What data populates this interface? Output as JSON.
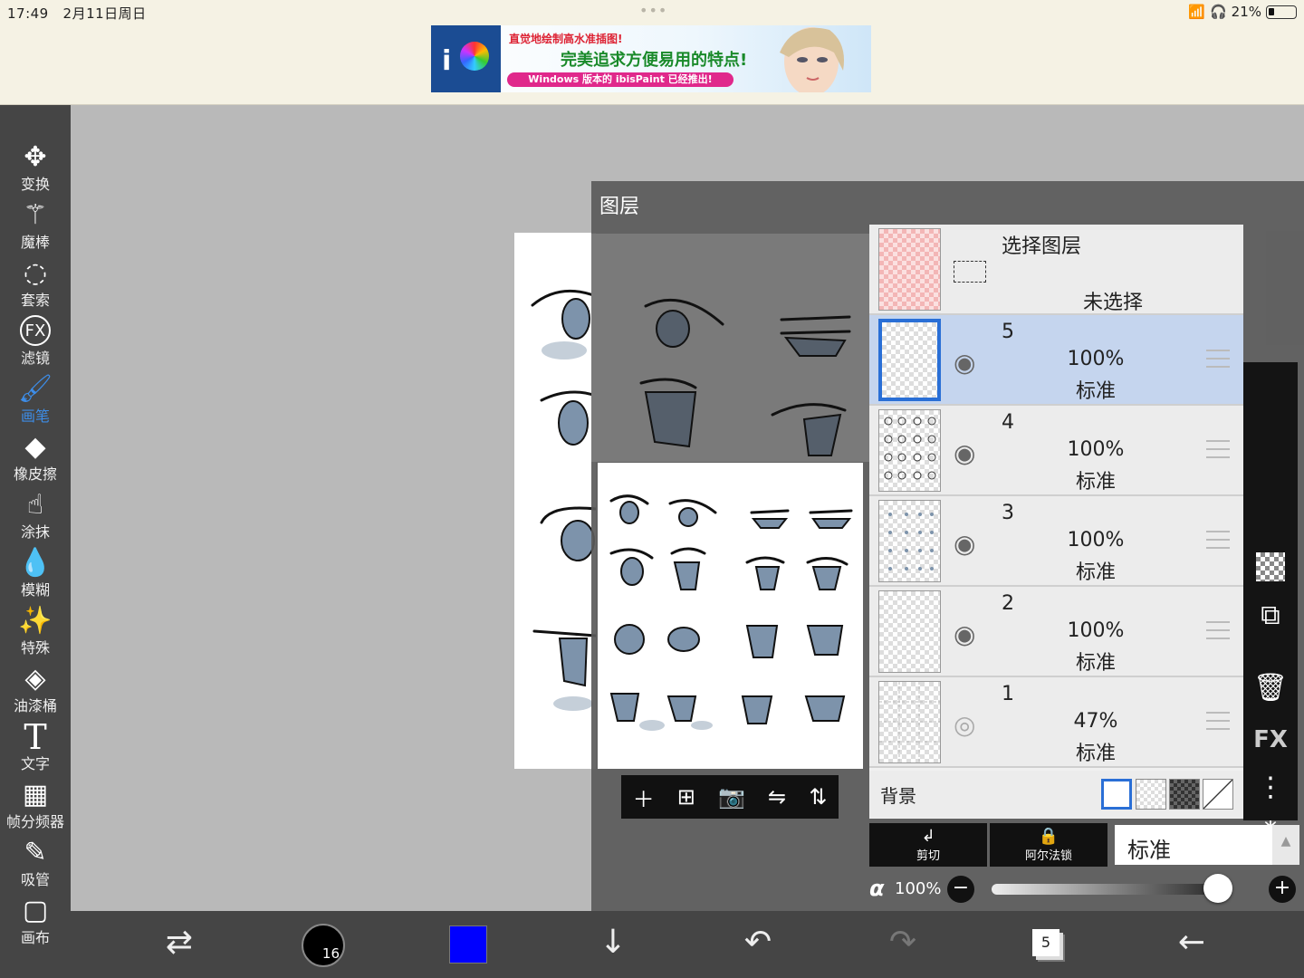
{
  "status": {
    "time": "17:49",
    "date": "2月11日周日",
    "battery": "21%"
  },
  "ad": {
    "line1": "直觉地绘制高水准插图!",
    "line2": "完美追求方便易用的特点!",
    "line3": "Windows 版本的 ibisPaint 已经推出!"
  },
  "tools": [
    {
      "label": "变换",
      "icon": "move-icon"
    },
    {
      "label": "魔棒",
      "icon": "magic-wand-icon"
    },
    {
      "label": "套索",
      "icon": "lasso-icon"
    },
    {
      "label": "滤镜",
      "icon": "fx-filter-icon"
    },
    {
      "label": "画笔",
      "icon": "brush-icon",
      "active": true
    },
    {
      "label": "橡皮擦",
      "icon": "eraser-icon"
    },
    {
      "label": "涂抹",
      "icon": "smudge-icon"
    },
    {
      "label": "模糊",
      "icon": "blur-drop-icon"
    },
    {
      "label": "特殊",
      "icon": "special-pen-icon"
    },
    {
      "label": "油漆桶",
      "icon": "paint-bucket-icon"
    },
    {
      "label": "文字",
      "icon": "text-icon"
    },
    {
      "label": "帧分频器",
      "icon": "frame-divider-icon"
    },
    {
      "label": "吸管",
      "icon": "eyedropper-icon"
    },
    {
      "label": "画布",
      "icon": "canvas-icon"
    }
  ],
  "layer_panel": {
    "title": "图层",
    "selection_layer": {
      "title": "选择图层",
      "status": "未选择"
    },
    "layers": [
      {
        "number": "5",
        "opacity": "100%",
        "blend": "标准",
        "selected": true,
        "visible": true
      },
      {
        "number": "4",
        "opacity": "100%",
        "blend": "标准",
        "selected": false,
        "visible": true
      },
      {
        "number": "3",
        "opacity": "100%",
        "blend": "标准",
        "selected": false,
        "visible": true
      },
      {
        "number": "2",
        "opacity": "100%",
        "blend": "标准",
        "selected": false,
        "visible": true
      },
      {
        "number": "1",
        "opacity": "47%",
        "blend": "标准",
        "selected": false,
        "visible": false
      }
    ],
    "background_label": "背景",
    "clip_label": "剪切",
    "alpha_lock_label": "阿尔法锁",
    "blend_mode": "标准",
    "alpha_symbol": "α",
    "alpha_value": "100%",
    "alpha_fraction": 1.0,
    "right_fx_label": "FX"
  },
  "bottom": {
    "brush_size": "16",
    "brush_color": "#0000ff",
    "layer_count": "5"
  },
  "colors": {
    "accent": "#3d8de8",
    "selected_row": "#c5d5ee",
    "toolbar": "#454545"
  }
}
